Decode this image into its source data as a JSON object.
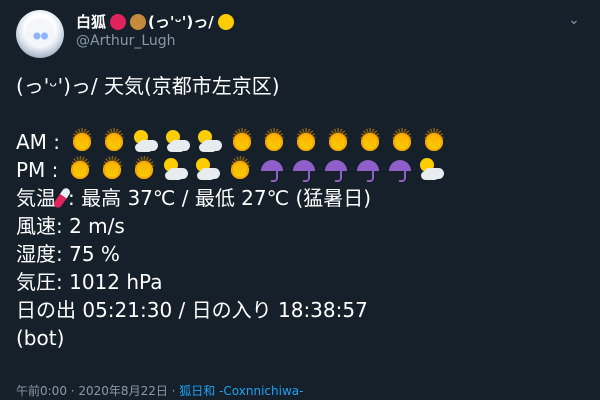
{
  "tweet": {
    "display_name": "白狐",
    "display_name_suffix": "(っ'ᵕ')っ/",
    "handle": "@Arthur_Lugh",
    "lines": {
      "intro": "(っ'ᵕ')っ/ 天気(京都市左京区)",
      "am_label": "AM :",
      "am_icons": [
        "sun",
        "sun",
        "cloud",
        "cloud",
        "cloud",
        "sun",
        "sun",
        "sun",
        "sun",
        "sun",
        "sun",
        "sun"
      ],
      "pm_label": "PM :",
      "pm_icons": [
        "sun",
        "sun",
        "sun",
        "cloud",
        "cloud",
        "sun",
        "umbrella",
        "umbrella",
        "umbrella",
        "umbrella",
        "umbrella",
        "cloud"
      ],
      "temp_label": "気温",
      "temp_value": ": 最高 37℃ / 最低 27℃ (猛暑日)",
      "wind": "風速: 2 m/s",
      "humidity": "湿度: 75 %",
      "pressure": "気圧: 1012 hPa",
      "sun": "日の出 05:21:30 / 日の入り 18:38:57",
      "bot": "(bot)"
    },
    "footer": {
      "time": "午前0:00 · 2020年8月22日 · ",
      "app": "狐日和 -Coxnnichiwa-"
    },
    "colors": {
      "background": "#15202b",
      "secondary": "#8899a6",
      "link": "#1da1f2"
    }
  }
}
